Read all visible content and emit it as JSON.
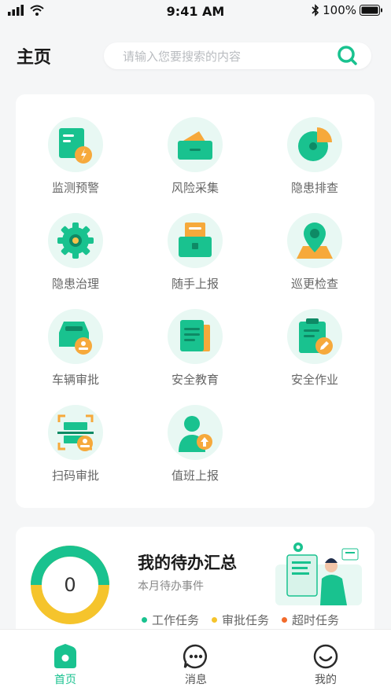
{
  "status_bar": {
    "time": "9:41 AM",
    "battery": "100%"
  },
  "header": {
    "title": "主页"
  },
  "search": {
    "placeholder": "请输入您要搜索的内容"
  },
  "grid": {
    "items": [
      {
        "label": "监测预警",
        "icon": "monitor-warning-icon"
      },
      {
        "label": "风险采集",
        "icon": "risk-collect-icon"
      },
      {
        "label": "隐患排查",
        "icon": "hazard-check-icon"
      },
      {
        "label": "隐患治理",
        "icon": "hazard-govern-icon"
      },
      {
        "label": "随手上报",
        "icon": "quick-report-icon"
      },
      {
        "label": "巡更检查",
        "icon": "patrol-icon"
      },
      {
        "label": "车辆审批",
        "icon": "vehicle-approval-icon"
      },
      {
        "label": "安全教育",
        "icon": "safety-education-icon"
      },
      {
        "label": "安全作业",
        "icon": "safety-work-icon"
      },
      {
        "label": "扫码审批",
        "icon": "scan-approval-icon"
      },
      {
        "label": "值班上报",
        "icon": "duty-report-icon"
      }
    ]
  },
  "todo": {
    "title": "我的待办汇总",
    "subtitle": "本月待办事件",
    "count": "0",
    "legend": [
      {
        "label": "工作任务",
        "color": "#19c28f"
      },
      {
        "label": "审批任务",
        "color": "#f5c42c"
      },
      {
        "label": "超时任务",
        "color": "#f26b2b"
      }
    ],
    "ring_colors": {
      "primary": "#19c28f",
      "secondary": "#f5c42c"
    }
  },
  "tabbar": {
    "tabs": [
      {
        "label": "首页",
        "icon": "home-icon",
        "active": true
      },
      {
        "label": "消息",
        "icon": "message-icon",
        "active": false
      },
      {
        "label": "我的",
        "icon": "profile-icon",
        "active": false
      }
    ]
  },
  "colors": {
    "accent": "#19c28f",
    "accent_light": "#e8f8f3",
    "orange": "#f6a93b"
  }
}
